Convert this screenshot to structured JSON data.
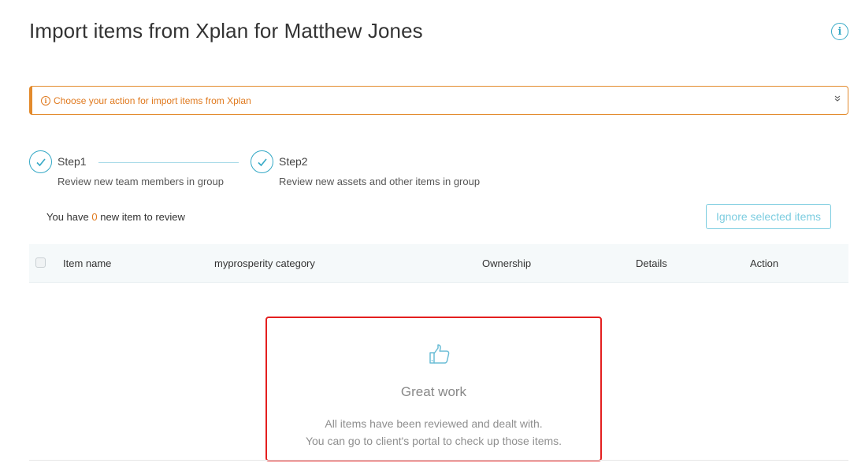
{
  "header": {
    "title_prefix": "Import items from Xplan for",
    "client_name": "Matthew Jones",
    "info_icon": "info-circle-icon"
  },
  "banner": {
    "text": "Choose your action for import items from Xplan",
    "icon": "info-circle-icon",
    "chevron": "double-chevron-down-icon",
    "color": "#e07a1f"
  },
  "steps": [
    {
      "name": "Step1",
      "description": "Review new team members in group",
      "icon": "check-icon"
    },
    {
      "name": "Step2",
      "description": "Review new assets and other items in group",
      "icon": "check-icon"
    }
  ],
  "review": {
    "prefix": "You have",
    "count": "0",
    "suffix": "new item to review"
  },
  "ignore_button": "Ignore selected items",
  "table": {
    "columns": [
      "Item name",
      "myprosperity category",
      "Ownership",
      "Details",
      "Action"
    ]
  },
  "empty_state": {
    "icon": "thumbs-up-icon",
    "title": "Great work",
    "line1": "All items have been reviewed and dealt with.",
    "line2": "You can go to client's portal to check up those items."
  },
  "colors": {
    "accent": "#36a9c6",
    "warning": "#e07a1f",
    "highlight_border": "#e41f1f"
  }
}
